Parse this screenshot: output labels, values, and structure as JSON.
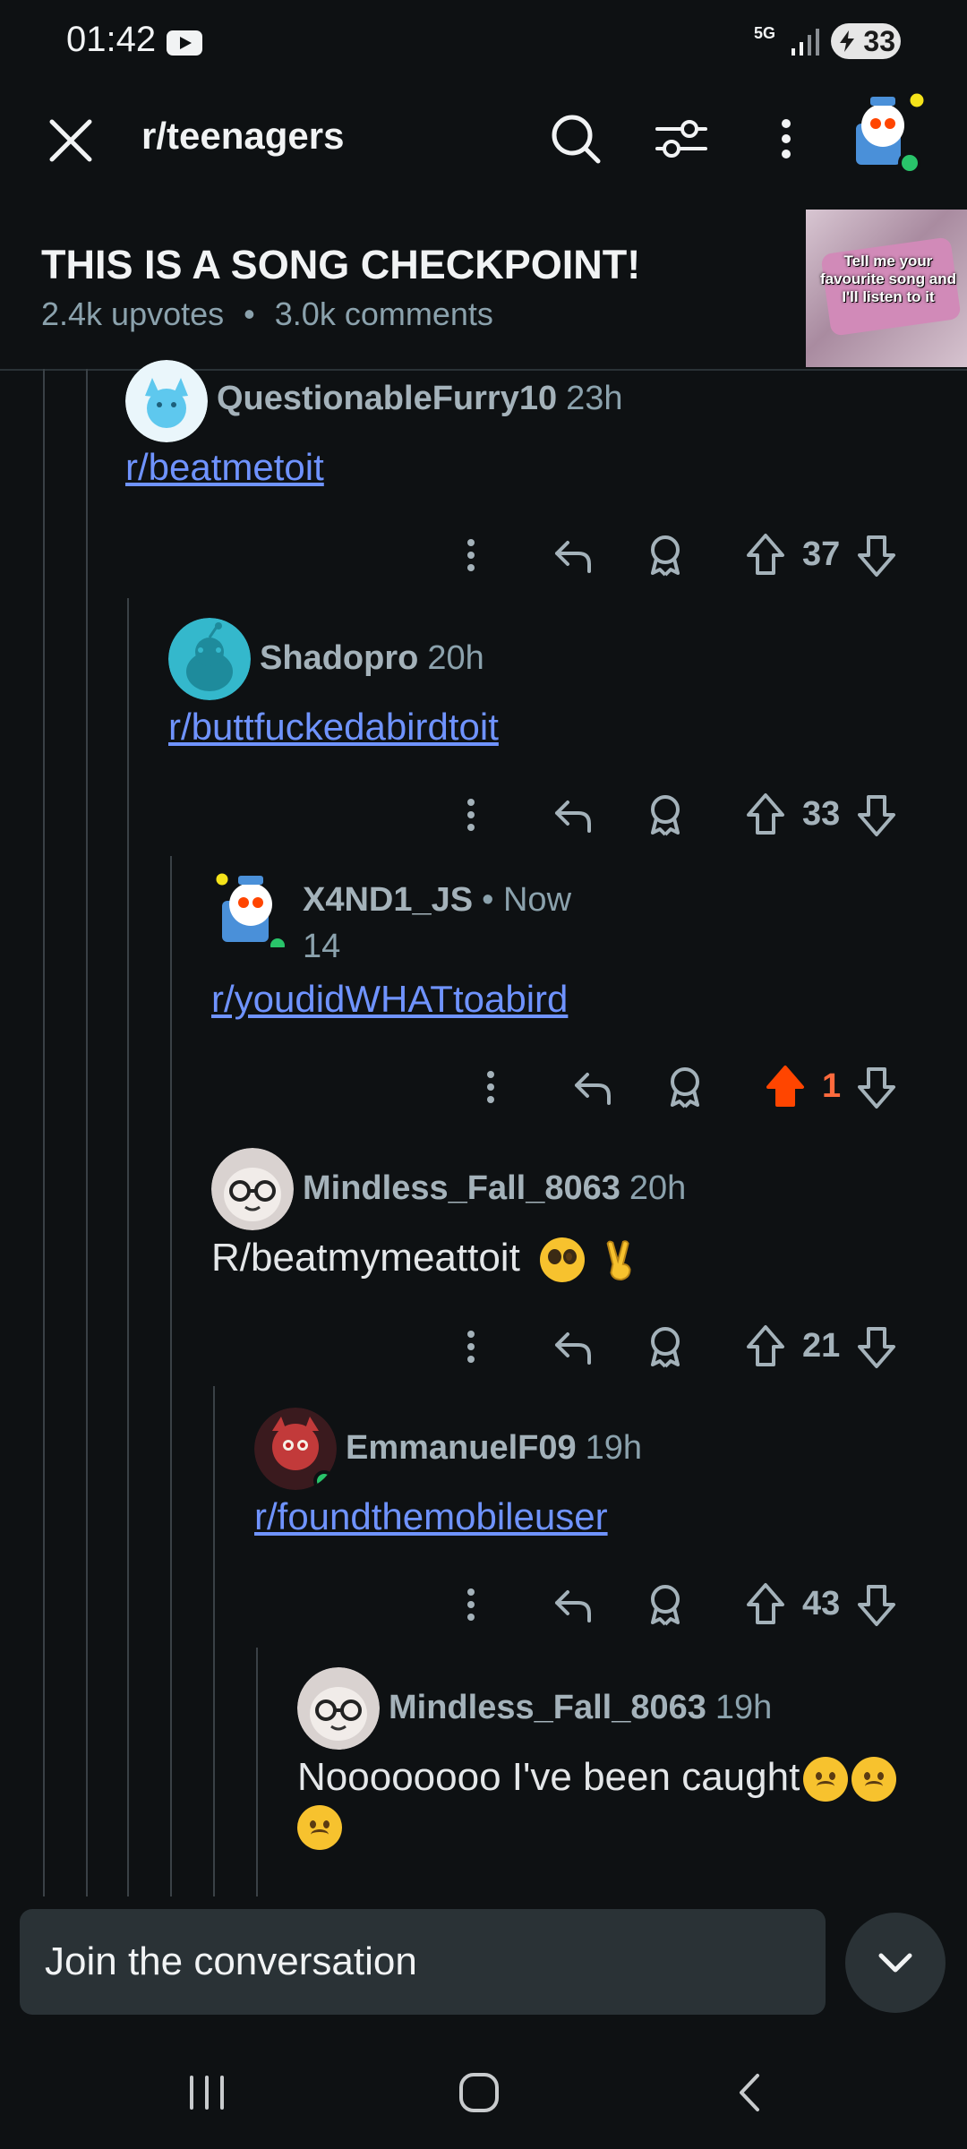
{
  "status_bar": {
    "time": "01:42",
    "network": "5G",
    "battery": "33"
  },
  "top_bar": {
    "subreddit": "r/teenagers"
  },
  "post": {
    "title": "THIS IS A SONG CHECKPOINT!",
    "upvotes": "2.4k upvotes",
    "separator": "•",
    "comments": "3.0k comments",
    "thumbnail_text": "Tell me your favourite song and I'll listen to it"
  },
  "comments": [
    {
      "username": "QuestionableFurry10",
      "time": "23h",
      "body": "r/beatmetoit",
      "votes": "37"
    },
    {
      "username": "Shadopro",
      "time": "20h",
      "body": "r/buttfuckedabirdtoit",
      "votes": "33"
    },
    {
      "username": "X4ND1_JS",
      "time": "• Now",
      "flair": "14",
      "body": "r/youdidWHATtoabird",
      "votes": "1"
    },
    {
      "username": "Mindless_Fall_8063",
      "time": "20h",
      "body": "R/beatmymeattoit",
      "votes": "21"
    },
    {
      "username": "EmmanuelF09",
      "time": "19h",
      "body": "r/foundthemobileuser",
      "votes": "43"
    },
    {
      "username": "Mindless_Fall_8063",
      "time": "19h",
      "body": "Noooooooo I've been caught"
    }
  ],
  "composer": {
    "placeholder": "Join the conversation"
  },
  "colors": {
    "background": "#0e1113",
    "link": "#6f93ff",
    "upvoted": "#ff6a3d"
  }
}
